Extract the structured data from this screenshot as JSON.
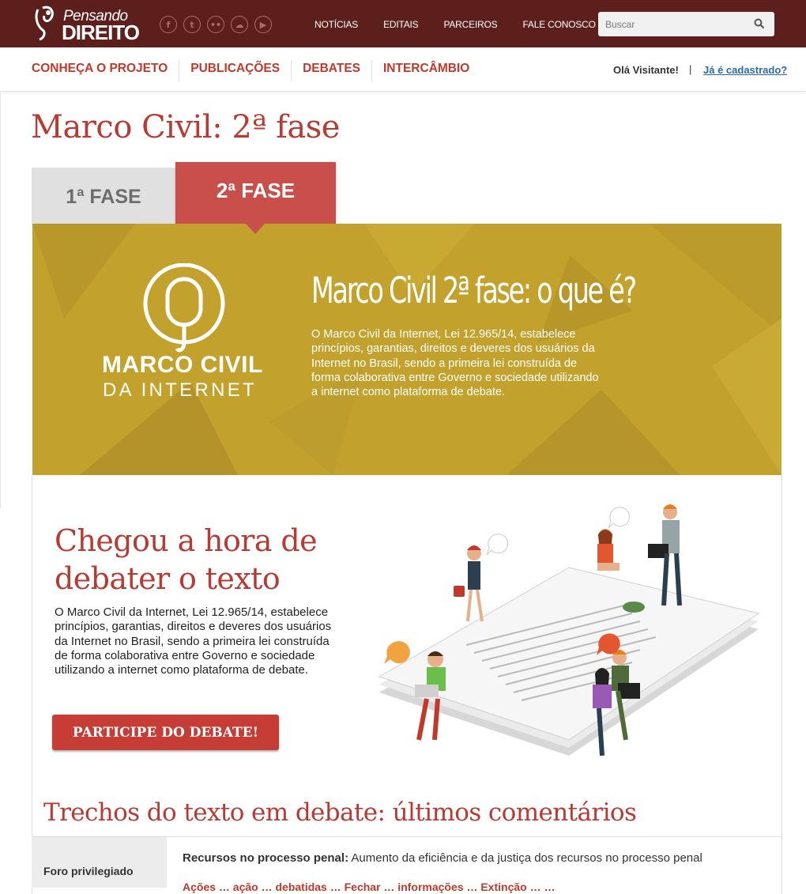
{
  "brand": {
    "line1": "Pensando",
    "line2": "DIREITO"
  },
  "social": [
    {
      "icon": "facebook-icon",
      "glyph": "f"
    },
    {
      "icon": "twitter-icon",
      "glyph": "t"
    },
    {
      "icon": "flickr-icon",
      "glyph": "••"
    },
    {
      "icon": "soundcloud-icon",
      "glyph": "☁"
    },
    {
      "icon": "youtube-icon",
      "glyph": "▶"
    }
  ],
  "topnav": {
    "news": "NOTÍCIAS",
    "notices": "EDITAIS",
    "partners": "PARCEIROS",
    "contact": "FALE CONOSCO"
  },
  "search": {
    "placeholder": "Buscar"
  },
  "subnav": {
    "project": "CONHEÇA O PROJETO",
    "publications": "PUBLICAÇÕES",
    "debates": "DEBATES",
    "exchange": "INTERCÂMBIO"
  },
  "user": {
    "greeting": "Olá Visitante!",
    "separator": "|",
    "login": "Já é cadastrado?"
  },
  "page": {
    "title": "Marco Civil: 2ª fase"
  },
  "tabs": {
    "phase1": "1ª FASE",
    "phase2": "2ª FASE"
  },
  "banner": {
    "logo_title": "MARCO CIVIL",
    "logo_subtitle": "DA INTERNET",
    "heading": "Marco Civil 2ª fase: o que é?",
    "text": "O Marco Civil da Internet, Lei 12.965/14, estabelece princípios, garantias, direitos e deveres dos usuários da Internet no Brasil, sendo a primeira lei construída de forma colaborativa entre Governo e sociedade utilizando a internet como plataforma de debate."
  },
  "section": {
    "heading_line1": "Chegou a hora de",
    "heading_line2": "debater o texto",
    "text": "O Marco Civil da Internet, Lei 12.965/14, estabelece princípios, garantias, direitos e deveres dos usuários da Internet no Brasil, sendo a primeira lei construída de forma colaborativa entre Governo e sociedade utilizando a internet como plataforma de debate.",
    "cta": "PARTICIPE DO DEBATE!"
  },
  "comments": {
    "heading": "Trechos do texto em debate: últimos comentários",
    "category": "Foro privilegiado",
    "row_title": "Recursos no processo penal:",
    "row_desc": " Aumento da eficiência e da justiça dos recursos no processo penal",
    "row_links": "Ações … ação … debatidas … Fechar … informações … Extinção … …"
  },
  "colors": {
    "topbar": "#5d1f1c",
    "accent": "#c0392b",
    "banner": "#c2a12c",
    "tab_active": "#c9504a"
  }
}
